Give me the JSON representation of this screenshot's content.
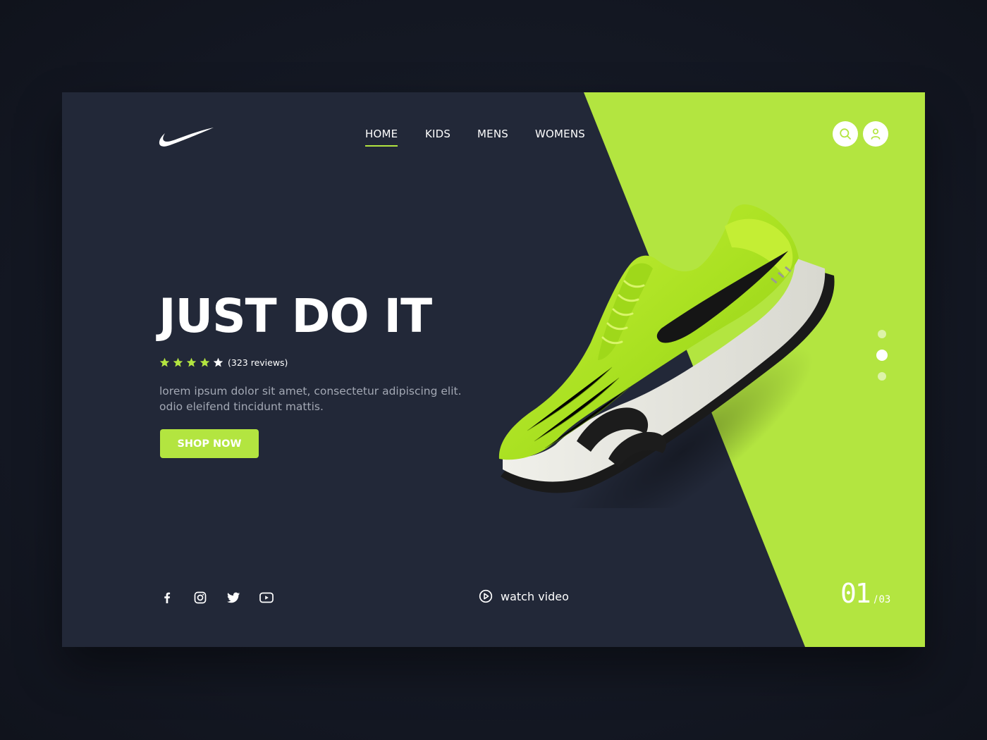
{
  "brand": {
    "logo": "swoosh-icon"
  },
  "nav": {
    "items": [
      {
        "label": "HOME",
        "active": true
      },
      {
        "label": "KIDS",
        "active": false
      },
      {
        "label": "MENS",
        "active": false
      },
      {
        "label": "WOMENS",
        "active": false
      }
    ]
  },
  "header_actions": [
    {
      "icon": "search-icon"
    },
    {
      "icon": "user-icon"
    }
  ],
  "hero": {
    "title": "JUST DO IT",
    "rating": {
      "stars": 5,
      "filled": 4
    },
    "reviews": "(323 reviews)",
    "description": "lorem ipsum dolor sit amet, consectetur adipiscing elit. odio eleifend tincidunt mattis.",
    "cta": "SHOP NOW"
  },
  "product": {
    "image": "green-sneaker"
  },
  "slider": {
    "dots": 3,
    "active_index": 1,
    "current": "01",
    "separator": "/",
    "total": "03"
  },
  "socials": [
    {
      "icon": "facebook-icon"
    },
    {
      "icon": "instagram-icon"
    },
    {
      "icon": "twitter-icon"
    },
    {
      "icon": "youtube-icon"
    }
  ],
  "video": {
    "icon": "play-icon",
    "label": "watch video"
  },
  "colors": {
    "accent": "#b3e540",
    "card_background": "#222838",
    "page_background": "#141824"
  }
}
